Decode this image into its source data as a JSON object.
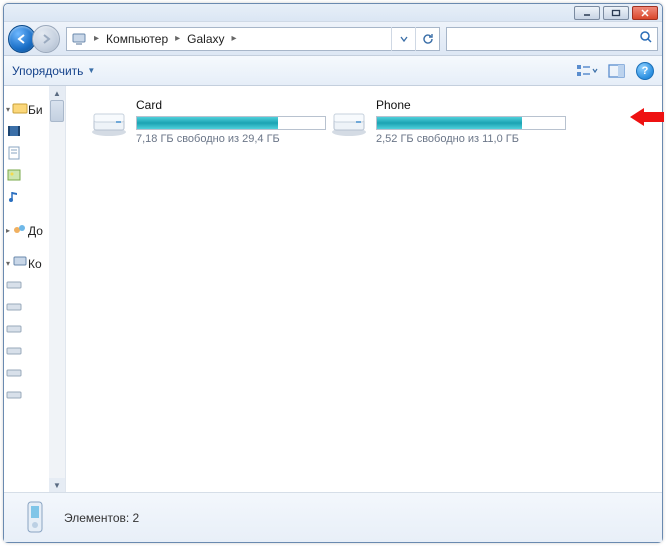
{
  "breadcrumb": {
    "root_icon": "computer",
    "items": [
      "Компьютер",
      "Galaxy"
    ]
  },
  "search": {
    "placeholder": ""
  },
  "toolbar": {
    "organize_label": "Упорядочить"
  },
  "sidebar": {
    "group1": {
      "label": "Би"
    },
    "group2": {
      "label": "До"
    },
    "group3": {
      "label": "Ко"
    }
  },
  "drives": [
    {
      "name": "Card",
      "status": "7,18 ГБ свободно из 29,4 ГБ",
      "used_pct": 75
    },
    {
      "name": "Phone",
      "status": "2,52 ГБ свободно из 11,0 ГБ",
      "used_pct": 77
    }
  ],
  "details": {
    "text": "Элементов: 2"
  }
}
